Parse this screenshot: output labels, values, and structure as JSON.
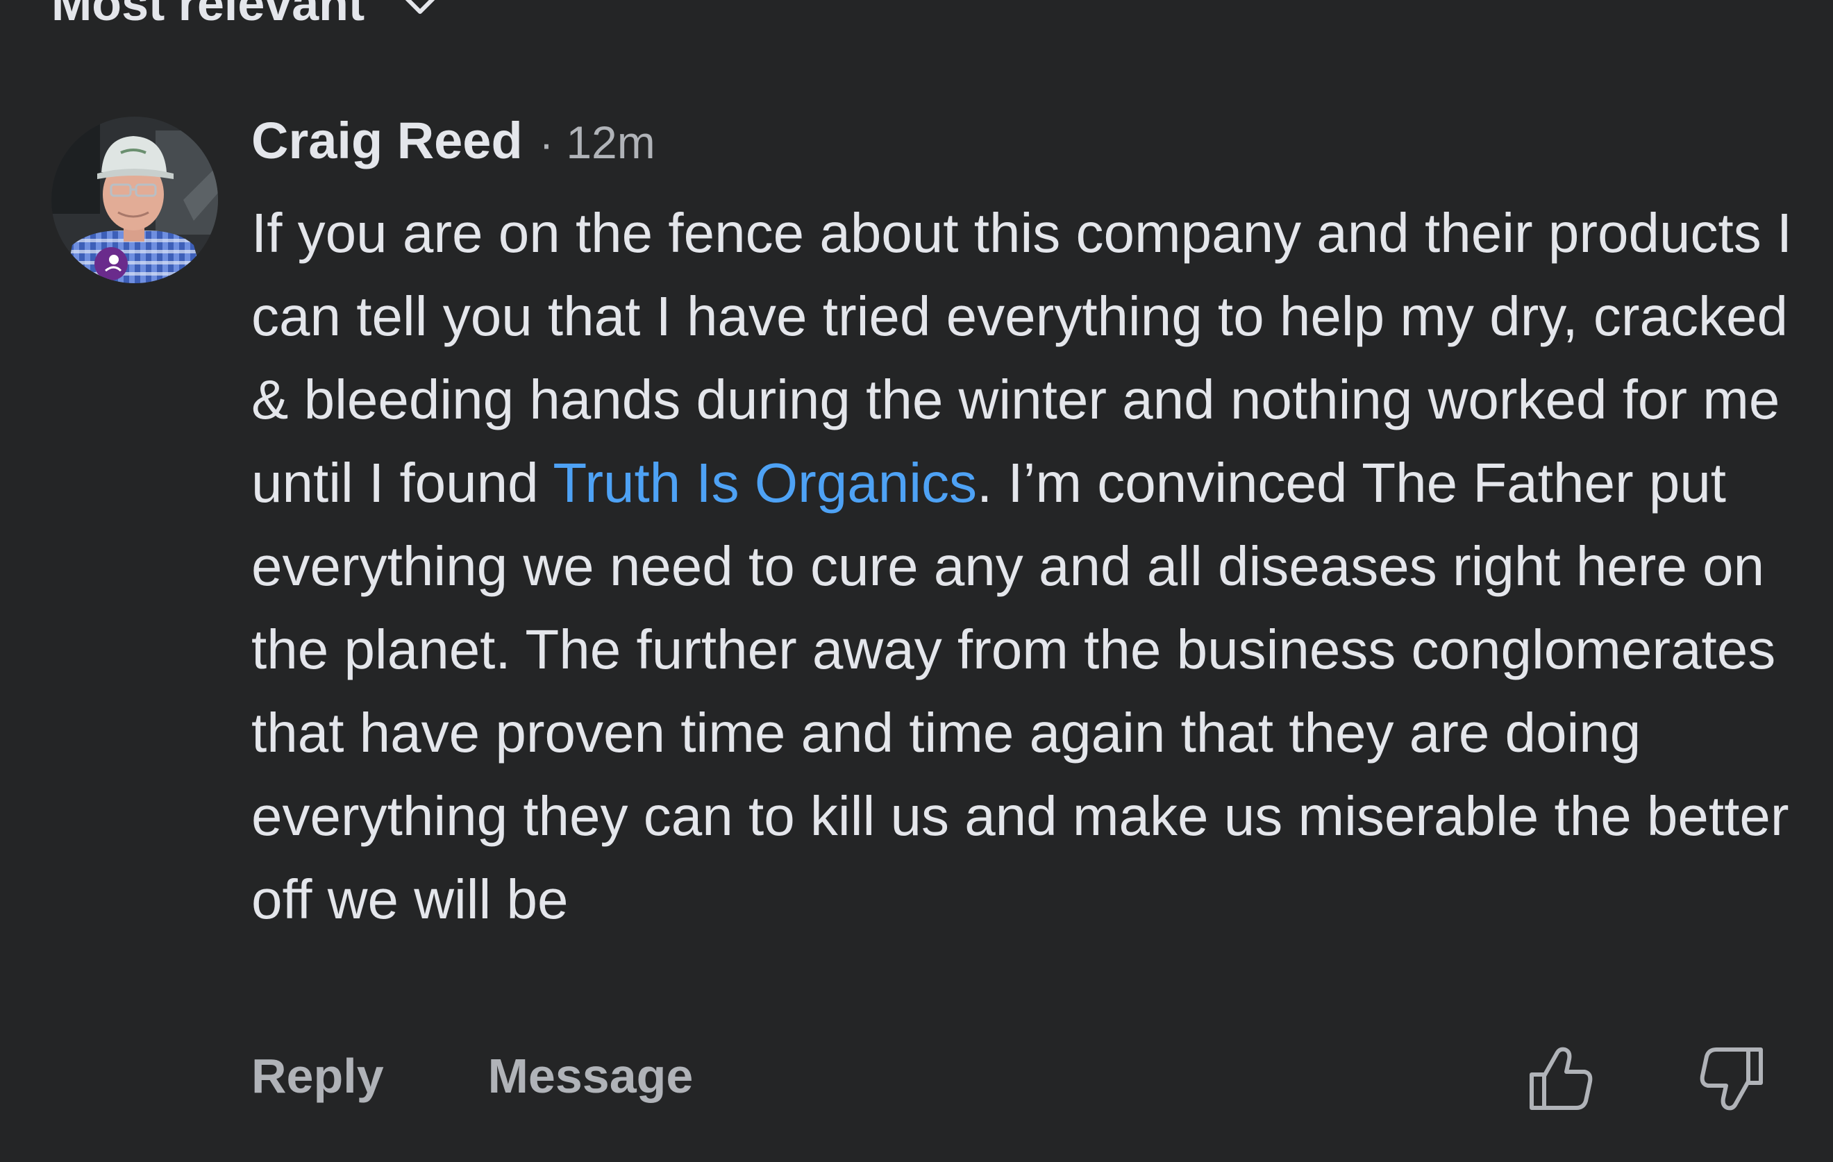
{
  "sort": {
    "label": "Most relevant",
    "chevron_icon": "chevron-down-icon"
  },
  "comment": {
    "author": "Craig Reed",
    "separator": "·",
    "time": "12m",
    "text_before": "If you are on the fence about this company and their products I can tell you that I have tried everything to help my dry, cracked & bleeding hands during the winter and nothing worked for me until I found ",
    "mention": "Truth Is Organics",
    "text_after": ". I’m convinced The Father put everything we need to cure any and all diseases right here on the planet. The further away from the business conglomerates that have proven time and time again that they are doing everything they can to kill us and make us miserable the better off we will be"
  },
  "actions": {
    "reply_label": "Reply",
    "message_label": "Message",
    "like_icon": "thumbs-up-icon",
    "dislike_icon": "thumbs-down-icon"
  },
  "colors": {
    "background": "#242526",
    "text_primary": "#e4e6eb",
    "text_secondary": "#b0b3b8",
    "mention": "#4ea2f5"
  }
}
